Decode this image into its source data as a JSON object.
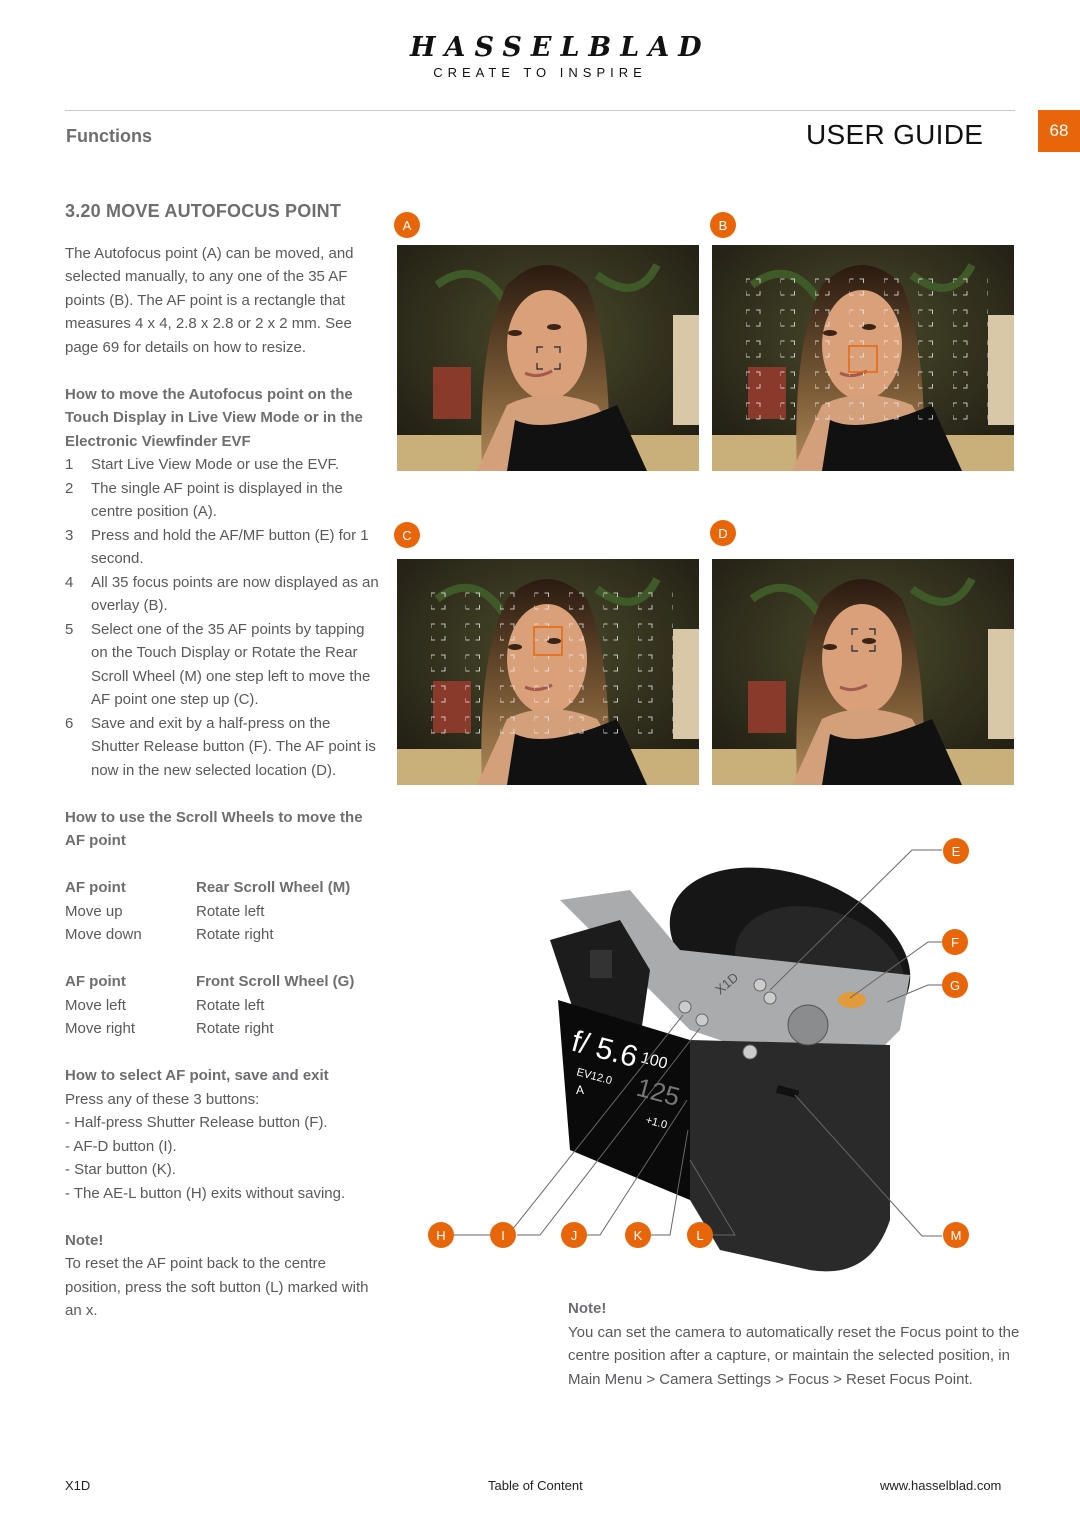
{
  "header": {
    "brand": "HASSELBLAD",
    "tagline": "CREATE TO INSPIRE",
    "section": "Functions",
    "doc_title": "USER GUIDE",
    "page_number": "68",
    "accent_color": "#e8650a"
  },
  "main": {
    "title": "3.20  MOVE AUTOFOCUS POINT",
    "intro": "The Autofocus point (A) can be moved, and selected manually, to any one of the 35 AF points (B). The AF point is a rectangle that measures 4 x 4, 2.8 x 2.8 or 2 x 2 mm. See page 69 for details on how to resize.",
    "touch_heading": "How to move the Autofocus point on the Touch Display in Live View Mode or in the Electronic Viewfinder EVF",
    "steps": [
      {
        "n": "1",
        "text": "Start Live View Mode or use the EVF."
      },
      {
        "n": "2",
        "text": "The single AF point is displayed in the centre position (A)."
      },
      {
        "n": "3",
        "text": "Press and hold the AF/MF button (E) for 1 second."
      },
      {
        "n": "4",
        "text": "All 35 focus points are now displayed as an overlay (B)."
      },
      {
        "n": "5",
        "text": "Select one of the 35 AF points by tapping on the Touch Display or Rotate the Rear Scroll Wheel (M) one step left to move the AF point one step up (C)."
      },
      {
        "n": "6",
        "text": "Save and exit by a half-press on the Shutter Release button (F). The AF point is now in the new selected location (D)."
      }
    ],
    "scroll_heading": "How to use the Scroll Wheels to move the AF point",
    "rear_table": {
      "headers": [
        "AF point",
        "Rear Scroll Wheel (M)"
      ],
      "rows": [
        [
          "Move up",
          "Rotate left"
        ],
        [
          "Move down",
          "Rotate right"
        ]
      ]
    },
    "front_table": {
      "headers": [
        "AF point",
        "Front Scroll Wheel (G)"
      ],
      "rows": [
        [
          "Move left",
          "Rotate left"
        ],
        [
          "Move right",
          "Rotate right"
        ]
      ]
    },
    "select_heading": "How to select AF point, save and exit",
    "select_intro": "Press any of these 3 buttons:",
    "select_items": [
      "- Half-press Shutter Release button (F).",
      "- AF-D button (I).",
      "- Star button (K).",
      "- The AE-L button (H) exits without saving."
    ],
    "note_heading": "Note!",
    "note_text": "To reset the AF point back to the centre position, press the soft button (L) marked with an x."
  },
  "figures": {
    "labels": [
      "A",
      "B",
      "C",
      "D"
    ],
    "callouts": [
      "E",
      "F",
      "G",
      "H",
      "I",
      "J",
      "K",
      "L",
      "M"
    ],
    "screen": {
      "aperture": "f/ 5.6",
      "iso": "100",
      "ev": "EV12.0",
      "shutter": "125",
      "comp": "+1.0",
      "mode": "A",
      "model": "X1D"
    }
  },
  "note2": {
    "heading": "Note!",
    "text": "You can set the camera to automatically reset the Focus point to the centre position after a capture, or maintain the selected position, in Main Menu > Camera Settings > Focus > Reset Focus Point."
  },
  "footer": {
    "model": "X1D",
    "toc": "Table of Content",
    "url": "www.hasselblad.com"
  }
}
